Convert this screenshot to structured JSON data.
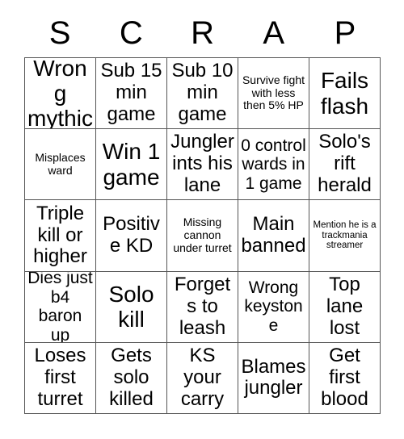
{
  "card": {
    "header_letters": [
      "S",
      "C",
      "R",
      "A",
      "P"
    ],
    "grid": {
      "rows": 5,
      "columns": 5,
      "border_color": "#555555",
      "background_color": "#ffffff",
      "text_color": "#000000"
    },
    "cells": [
      {
        "text": "Wrong mythic",
        "size": "xl",
        "marked": false
      },
      {
        "text": "Sub 15 min game",
        "size": "lg",
        "marked": false
      },
      {
        "text": "Sub 10 min game",
        "size": "lg",
        "marked": false
      },
      {
        "text": "Survive fight with less then 5% HP",
        "size": "sm",
        "marked": false
      },
      {
        "text": "Fails flash",
        "size": "xl",
        "marked": false
      },
      {
        "text": "Misplaces ward",
        "size": "sm",
        "marked": false
      },
      {
        "text": "Win 1 game",
        "size": "xl",
        "marked": false
      },
      {
        "text": "Jungler ints his lane",
        "size": "lg",
        "marked": false
      },
      {
        "text": "0 control wards in 1 game",
        "size": "md",
        "marked": false
      },
      {
        "text": "Solo's rift herald",
        "size": "lg",
        "marked": false
      },
      {
        "text": "Triple kill or higher",
        "size": "lg",
        "marked": false
      },
      {
        "text": "Positive KD",
        "size": "lg",
        "marked": false
      },
      {
        "text": "Missing cannon under turret",
        "size": "sm",
        "marked": false
      },
      {
        "text": "Main banned",
        "size": "lg",
        "marked": false
      },
      {
        "text": "Mention he is a trackmania streamer",
        "size": "xs",
        "marked": false
      },
      {
        "text": "Dies just b4 baron up",
        "size": "md",
        "marked": false
      },
      {
        "text": "Solo kill",
        "size": "xl",
        "marked": false
      },
      {
        "text": "Forgets to leash",
        "size": "lg",
        "marked": false
      },
      {
        "text": "Wrong keystone",
        "size": "md",
        "marked": false
      },
      {
        "text": "Top lane lost",
        "size": "lg",
        "marked": false
      },
      {
        "text": "Loses first turret",
        "size": "lg",
        "marked": false
      },
      {
        "text": "Gets solo killed",
        "size": "lg",
        "marked": false
      },
      {
        "text": "KS your carry",
        "size": "lg",
        "marked": false
      },
      {
        "text": "Blames jungler",
        "size": "lg",
        "marked": false
      },
      {
        "text": "Get first blood",
        "size": "lg",
        "marked": false
      }
    ]
  }
}
